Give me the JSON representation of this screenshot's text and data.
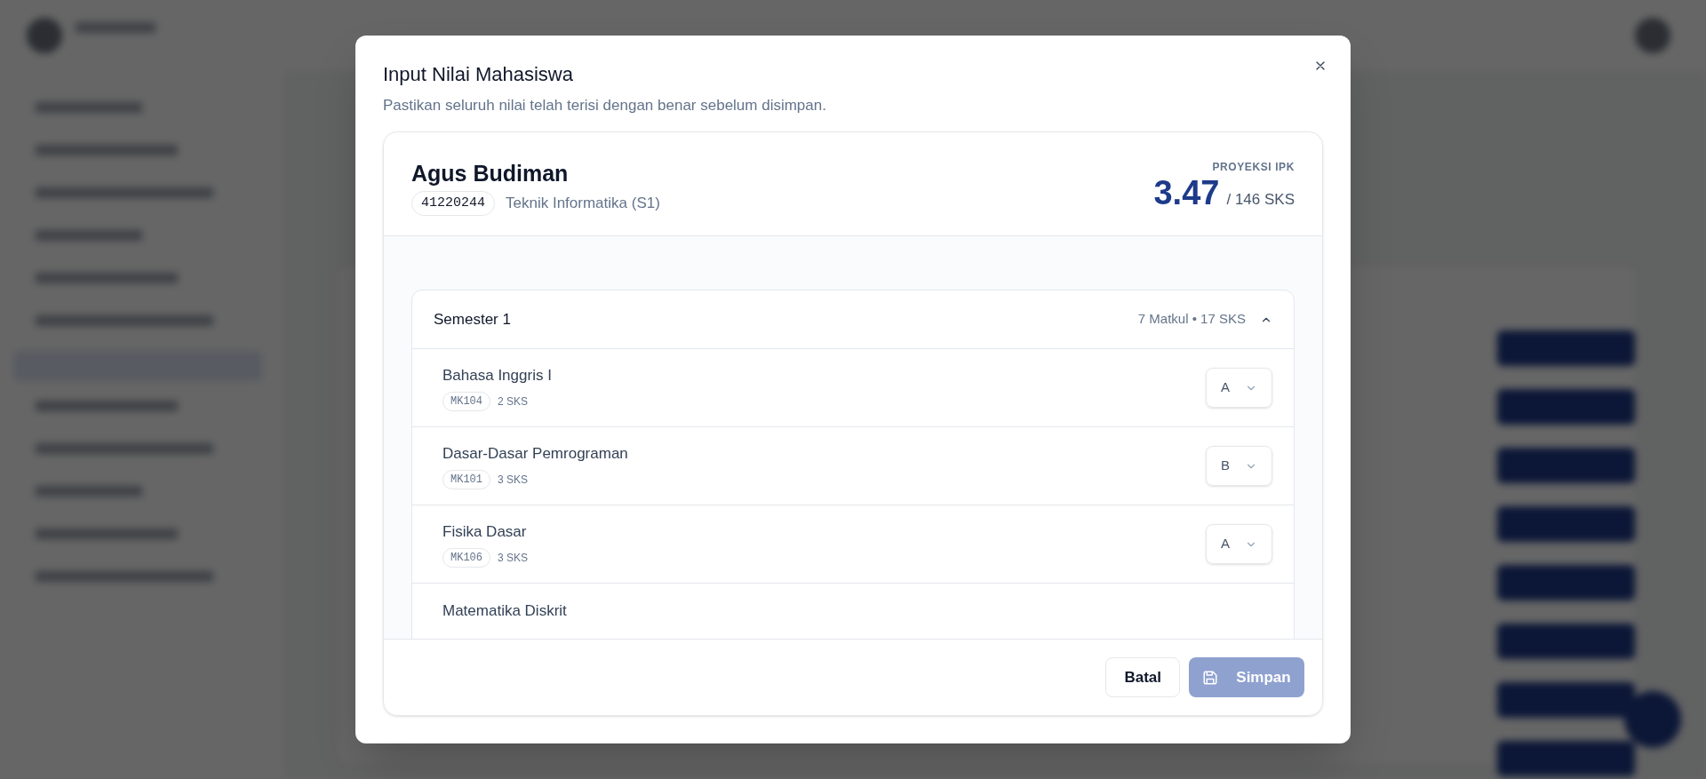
{
  "dialog": {
    "title": "Input Nilai Mahasiswa",
    "description": "Pastikan seluruh nilai telah terisi dengan benar sebelum disimpan.",
    "student": {
      "name": "Agus Budiman",
      "nim": "41220244",
      "program": "Teknik Informatika (S1)",
      "projection_label": "PROYEKSI IPK",
      "ipk": "3.47",
      "total_sks": "/ 146 SKS"
    },
    "semesters": [
      {
        "title": "Semester 1",
        "summary": "7 Matkul • 17 SKS",
        "expanded": true,
        "courses": [
          {
            "kind": "full",
            "name": "Bahasa Inggris I",
            "code": "MK104",
            "sks": "2 SKS",
            "grade": "A"
          },
          {
            "kind": "full",
            "name": "Dasar-Dasar Pemrograman",
            "code": "MK101",
            "sks": "3 SKS",
            "grade": "B"
          },
          {
            "kind": "full",
            "name": "Fisika Dasar",
            "code": "MK106",
            "sks": "3 SKS",
            "grade": "A"
          },
          {
            "kind": "partial",
            "name": "Matematika Diskrit"
          }
        ]
      }
    ],
    "buttons": {
      "cancel": "Batal",
      "save": "Simpan",
      "save_disabled": true
    }
  }
}
